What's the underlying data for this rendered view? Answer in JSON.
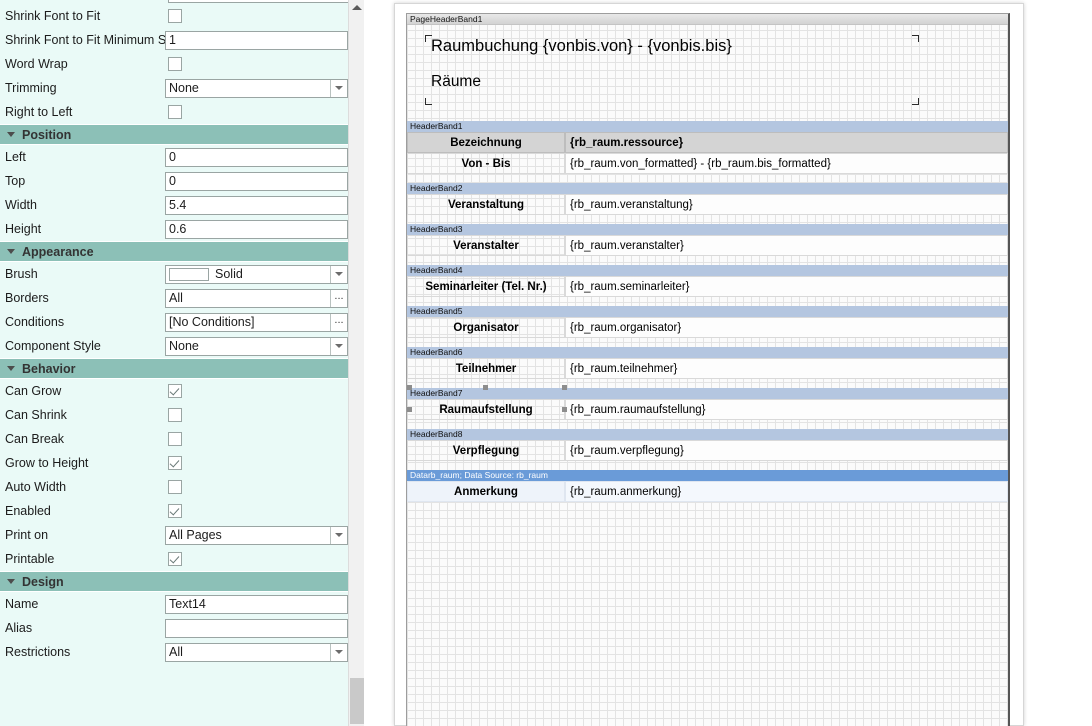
{
  "property_panel": {
    "partial_top_field": {
      "value": ""
    },
    "groups": [
      {
        "id": "text-options",
        "header": null,
        "rows": [
          {
            "label": "Shrink Font to Fit",
            "type": "checkbox",
            "checked": false,
            "name": "shrink-font-to-fit"
          },
          {
            "label": "Shrink Font to Fit Minimum Si",
            "type": "text",
            "value": "1",
            "name": "shrink-font-minimum-size"
          },
          {
            "label": "Word Wrap",
            "type": "checkbox",
            "checked": false,
            "name": "word-wrap"
          },
          {
            "label": "Trimming",
            "type": "dropdown",
            "value": "None",
            "name": "trimming"
          },
          {
            "label": "Right to Left",
            "type": "checkbox",
            "checked": false,
            "name": "right-to-left"
          }
        ]
      },
      {
        "id": "position",
        "header": "Position",
        "rows": [
          {
            "label": "Left",
            "type": "text",
            "value": "0",
            "name": "left"
          },
          {
            "label": "Top",
            "type": "text",
            "value": "0",
            "name": "top"
          },
          {
            "label": "Width",
            "type": "text",
            "value": "5.4",
            "name": "width"
          },
          {
            "label": "Height",
            "type": "text",
            "value": "0.6",
            "name": "height"
          }
        ]
      },
      {
        "id": "appearance",
        "header": "Appearance",
        "rows": [
          {
            "label": "Brush",
            "type": "brush",
            "value": "Solid",
            "color": "#ffffff",
            "name": "brush"
          },
          {
            "label": "Borders",
            "type": "ellipsis",
            "value": "All",
            "name": "borders"
          },
          {
            "label": "Conditions",
            "type": "ellipsis",
            "value": "[No Conditions]",
            "name": "conditions"
          },
          {
            "label": "Component Style",
            "type": "dropdown",
            "value": "None",
            "name": "component-style"
          }
        ]
      },
      {
        "id": "behavior",
        "header": "Behavior",
        "rows": [
          {
            "label": "Can Grow",
            "type": "checkbox",
            "checked": true,
            "name": "can-grow"
          },
          {
            "label": "Can Shrink",
            "type": "checkbox",
            "checked": false,
            "name": "can-shrink"
          },
          {
            "label": "Can Break",
            "type": "checkbox",
            "checked": false,
            "name": "can-break"
          },
          {
            "label": "Grow to Height",
            "type": "checkbox",
            "checked": true,
            "name": "grow-to-height"
          },
          {
            "label": "Auto Width",
            "type": "checkbox",
            "checked": false,
            "name": "auto-width"
          },
          {
            "label": "Enabled",
            "type": "checkbox",
            "checked": true,
            "name": "enabled"
          },
          {
            "label": "Print on",
            "type": "dropdown",
            "value": "All Pages",
            "name": "print-on"
          },
          {
            "label": "Printable",
            "type": "checkbox",
            "checked": true,
            "name": "printable"
          }
        ]
      },
      {
        "id": "design",
        "header": "Design",
        "rows": [
          {
            "label": "Name",
            "type": "text",
            "value": "Text14",
            "name": "name"
          },
          {
            "label": "Alias",
            "type": "text",
            "value": "",
            "name": "alias"
          },
          {
            "label": "Restrictions",
            "type": "dropdown",
            "value": "All",
            "name": "restrictions"
          }
        ]
      }
    ]
  },
  "designer": {
    "page_header": {
      "caption": "PageHeaderBand1",
      "title": "Raumbuchung {vonbis.von} - {vonbis.bis}",
      "subtitle": "Räume"
    },
    "bands": [
      {
        "caption": "HeaderBand1",
        "type": "header",
        "rows": [
          {
            "label": "Bezeichnung",
            "expr": "{rb_raum.ressource}",
            "style": "grey",
            "selected": false
          },
          {
            "label": "Von - Bis",
            "expr": "{rb_raum.von_formatted} - {rb_raum.bis_formatted}",
            "style": "light",
            "selected": false
          }
        ]
      },
      {
        "caption": "HeaderBand2",
        "type": "header",
        "rows": [
          {
            "label": "Veranstaltung",
            "expr": "{rb_raum.veranstaltung}",
            "style": "light",
            "selected": false
          }
        ]
      },
      {
        "caption": "HeaderBand3",
        "type": "header",
        "rows": [
          {
            "label": "Veranstalter",
            "expr": "{rb_raum.veranstalter}",
            "style": "light",
            "selected": false
          }
        ]
      },
      {
        "caption": "HeaderBand4",
        "type": "header",
        "rows": [
          {
            "label": "Seminarleiter (Tel. Nr.)",
            "expr": "{rb_raum.seminarleiter}",
            "style": "light",
            "selected": false
          }
        ]
      },
      {
        "caption": "HeaderBand5",
        "type": "header",
        "rows": [
          {
            "label": "Organisator",
            "expr": "{rb_raum.organisator}",
            "style": "light",
            "selected": false
          }
        ]
      },
      {
        "caption": "HeaderBand6",
        "type": "header",
        "rows": [
          {
            "label": "Teilnehmer",
            "expr": "{rb_raum.teilnehmer}",
            "style": "light",
            "selected": false
          }
        ]
      },
      {
        "caption": "HeaderBand7",
        "type": "header",
        "rows": [
          {
            "label": "Raumaufstellung",
            "expr": "{rb_raum.raumaufstellung}",
            "style": "light",
            "selected": true
          }
        ]
      },
      {
        "caption": "HeaderBand8",
        "type": "header",
        "rows": [
          {
            "label": "Verpflegung",
            "expr": "{rb_raum.verpflegung}",
            "style": "light",
            "selected": false
          }
        ]
      },
      {
        "caption": "Datarb_raum; Data Source: rb_raum",
        "type": "data",
        "rows": [
          {
            "label": "Anmerkung",
            "expr": "{rb_raum.anmerkung}",
            "style": "tint",
            "selected": false
          }
        ]
      }
    ]
  },
  "colors": {
    "panel_background": "#eafaf7",
    "section_header": "#8cc0b7",
    "header_band_caption": "#b4c6e0",
    "data_band_caption": "#6a9bd8",
    "selection_handle": "#8d8d8d"
  }
}
